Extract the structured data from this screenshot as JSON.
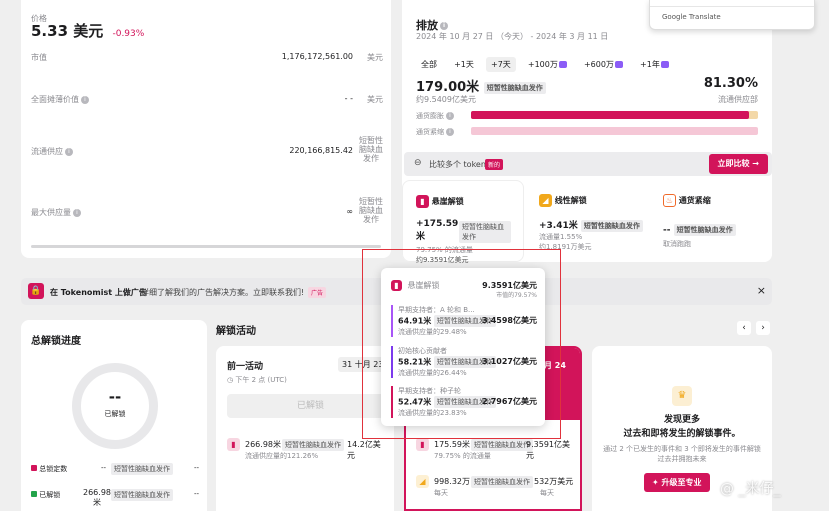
{
  "price": {
    "label": "价格",
    "value": "5.33 美元",
    "change": "-0.93%"
  },
  "stats": [
    {
      "label": "市值",
      "value": "1,176,172,561.00",
      "unit": "美元"
    },
    {
      "label": "全面摊薄价值",
      "value": "- -",
      "unit": "美元"
    },
    {
      "label": "流通供应",
      "value": "220,166,815.42",
      "unit": "短暂性脑缺血发作"
    },
    {
      "label": "最大供应量",
      "value": "∞",
      "unit": "短暂性脑缺血发作"
    }
  ],
  "google_translate": "Google Translate",
  "emission": {
    "title": "排放",
    "date_range": "2024 年 10 月 27 日 （今天） - 2024 年 3 月 11 日",
    "filters": [
      "全部",
      "+1天",
      "+7天",
      "+100万",
      "+600万",
      "+1年"
    ],
    "amount": "179.00米",
    "amount_tag": "短暂性脑缺血发作",
    "amount_sub": "约9.5409亿美元",
    "percent": "81.30%",
    "percent_sub": "流通供应部",
    "inflation_label": "通货膨胀",
    "inflation_level": 0.97,
    "deflation_label": "通货紧缩",
    "compare_label": "比较多个 token",
    "compare_badge": "新的",
    "compare_btn": "立即比较 →"
  },
  "unlock_cards": [
    {
      "title": "悬崖解锁",
      "amount": "+175.59米",
      "tag": "短暂性脑缺血发作",
      "sub1": "79.75% 的流通量",
      "sub2": "约9.3591亿美元",
      "color": "#d2145a"
    },
    {
      "title": "线性解锁",
      "amount": "+3.41米",
      "tag": "短暂性脑缺血发作",
      "sub1": "流通量1.55%",
      "sub2": "约1.8191万美元",
      "color": "#f1a81b"
    },
    {
      "title": "通货紧缩",
      "amount": "--",
      "tag": "短暂性脑缺血发作",
      "sub1": "取消跑跑",
      "sub2": "",
      "color": "#f06a2a"
    }
  ],
  "ad": {
    "lead": "在 Tokenomist 上做广告",
    "text": "详细了解我们的广告解决方案。立即联系我们!",
    "badge": "广告",
    "close": "×"
  },
  "popup": {
    "title": "悬崖解锁",
    "total": "9.3591亿美元",
    "total_sub": "市值的79.57%",
    "items": [
      {
        "name": "早期支持者：A 轮和 B...",
        "amount": "64.91米",
        "tag": "短暂性脑缺血发作",
        "usd": "3.4598亿美元",
        "pct": "流通供应量的29.48%",
        "color": "#a855f7"
      },
      {
        "name": "初始核心贡献者",
        "amount": "58.21米",
        "tag": "短暂性脑缺血发作",
        "usd": "3.1027亿美元",
        "pct": "流通供应量的26.44%",
        "color": "#7c3aed"
      },
      {
        "name": "早期支持者：种子轮",
        "amount": "52.47米",
        "tag": "短暂性脑缺血发作",
        "usd": "2.7967亿美元",
        "pct": "流通供应量的23.83%",
        "color": "#d2145a"
      }
    ]
  },
  "progress": {
    "title": "总解锁进度",
    "center": "--",
    "center_sub": "已解锁",
    "rows": [
      {
        "label": "总锁定数",
        "value": "--",
        "tag": "短暂性脑缺血发作",
        "extra": "--",
        "color": "#d2145a"
      },
      {
        "label": "已解锁",
        "value": "266.98米",
        "tag": "短暂性脑缺血发作",
        "extra": "--",
        "color": "#22a34a"
      }
    ]
  },
  "activity": {
    "title": "解锁活动",
    "prev_title": "前一活动",
    "prev_date": "31 十月 23",
    "prev_time": "下午 2 点 (UTC)",
    "prev_btn": "已解锁",
    "prev_amount": "266.98米",
    "prev_tag": "短暂性脑缺血发作",
    "prev_usd": "14.2亿美元",
    "prev_pct": "流通供应量的121.26%",
    "next_date": "月 24",
    "next_rows": [
      {
        "amount": "175.59米",
        "tag": "短暂性脑缺血发作",
        "usd": "9.3591亿美元",
        "sub": "79.75% 的流通量",
        "color": "#d2145a"
      },
      {
        "amount": "998.32万",
        "tag": "短暂性脑缺血发作",
        "usd": "532万美元",
        "sub": "每天",
        "sub2": "每天",
        "color": "#f1a81b"
      }
    ]
  },
  "discover": {
    "title1": "发现更多",
    "title2": "过去和即将发生的解锁事件。",
    "text": "通过 2 个已发生的事件和 3 个即将发生的事件解锁过去并拥抱未来",
    "btn": "升级至专业"
  },
  "watermark": "@ _米仔_"
}
